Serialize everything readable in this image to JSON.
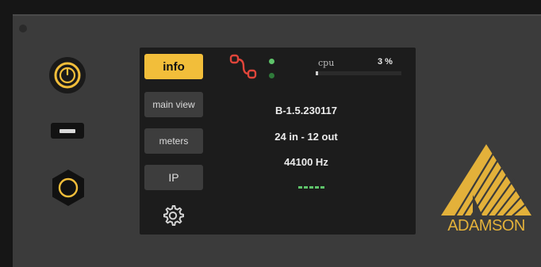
{
  "tabs": [
    {
      "label": "info",
      "active": true
    },
    {
      "label": "main view",
      "active": false
    },
    {
      "label": "meters",
      "active": false
    },
    {
      "label": "IP",
      "active": false
    }
  ],
  "status": {
    "cpu_label": "cpu",
    "cpu_value": "3 %",
    "cpu_fraction": 0.03
  },
  "info": {
    "firmware": "B-1.5.230117",
    "io": "24 in - 12 out",
    "sample_rate": "44100 Hz"
  },
  "brand": {
    "logo_text": "ADAMSON",
    "accent": "#f2be3a",
    "led_green": "#5ec36a"
  },
  "icons": [
    "power-icon",
    "usb-port",
    "encoder-knob",
    "gear-icon",
    "link-icon"
  ]
}
